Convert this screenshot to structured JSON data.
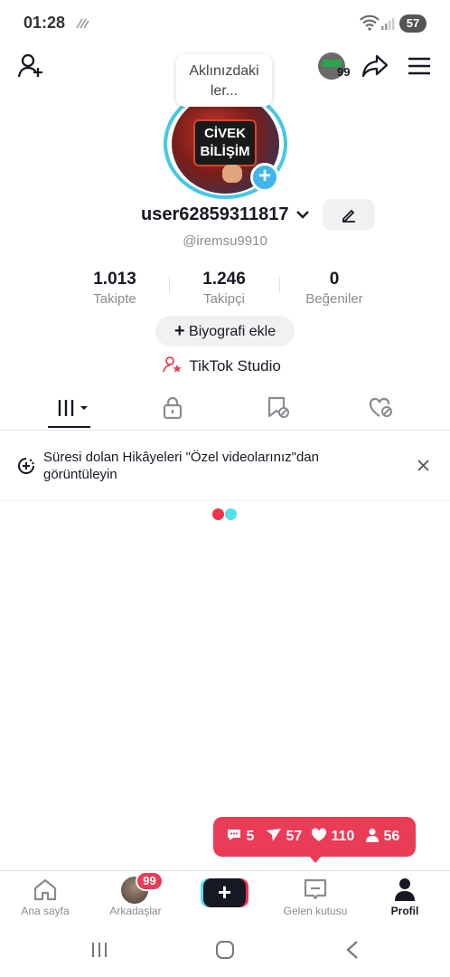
{
  "status_bar": {
    "time": "01:28",
    "battery": "57"
  },
  "header": {
    "story_badge_count": "99"
  },
  "profile": {
    "bubble_text_line1": "Aklınızdaki",
    "bubble_text_line2": "ler...",
    "avatar_text_line1": "CİVEK",
    "avatar_text_line2": "BİLİŞİM",
    "username": "user62859311817",
    "handle": "@iremsu9910",
    "stats": [
      {
        "value": "1.013",
        "label": "Takipte"
      },
      {
        "value": "1.246",
        "label": "Takipçi"
      },
      {
        "value": "0",
        "label": "Beğeniler"
      }
    ],
    "bio_button": "Biyografi ekle",
    "studio_label": "TikTok Studio"
  },
  "notice": {
    "text": "Süresi dolan Hikâyeleri \"Özel videolarınız\"dan görüntüleyin"
  },
  "notifications": {
    "comments": "5",
    "mentions": "57",
    "likes": "110",
    "followers": "56"
  },
  "bottom_nav": {
    "home": "Ana sayfa",
    "friends": "Arkadaşlar",
    "friends_badge": "99",
    "inbox": "Gelen kutusu",
    "profile": "Profil"
  },
  "colors": {
    "accent_red": "#ea3b57",
    "accent_cyan": "#4fe0ea",
    "ring": "#45c8e6"
  }
}
